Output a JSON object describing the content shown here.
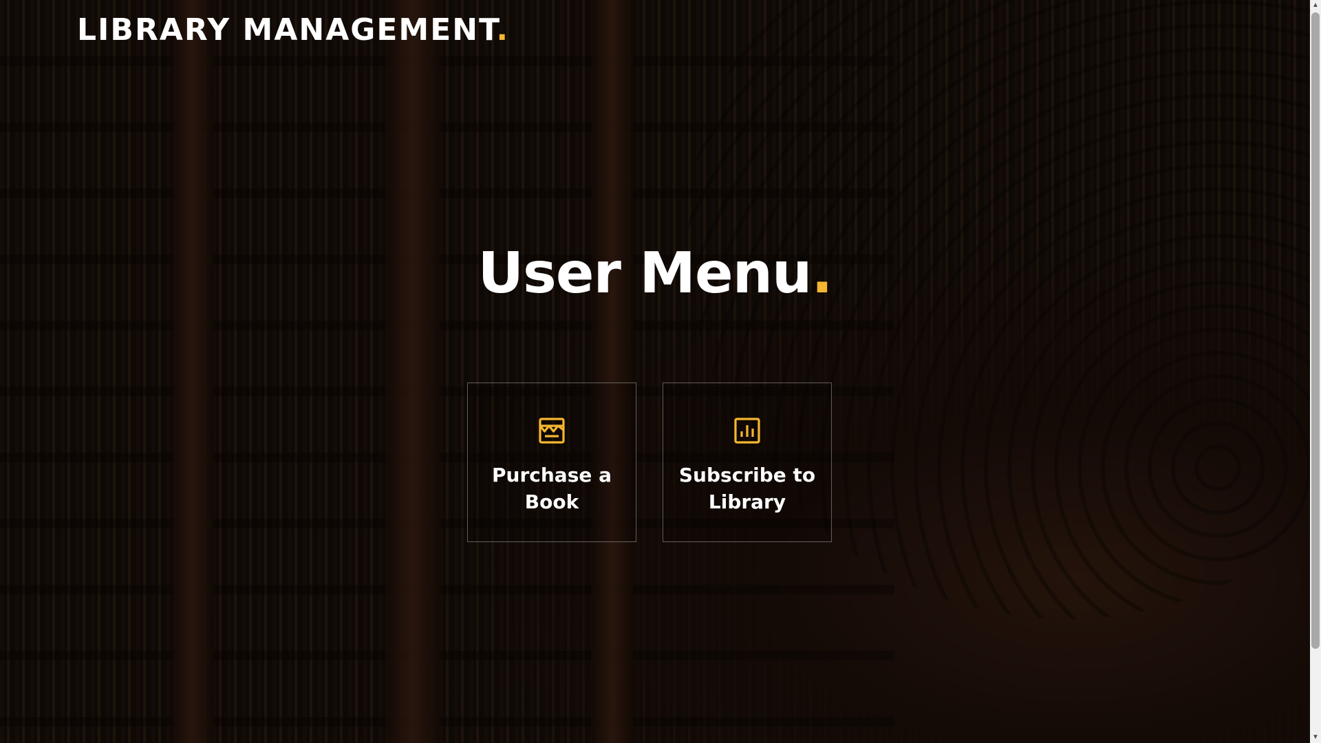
{
  "brand": {
    "text": "LIBRARY MANAGEMENT",
    "dot": "."
  },
  "page": {
    "title": "User Menu",
    "title_dot": "."
  },
  "cards": [
    {
      "label": "Purchase a Book",
      "icon": "store-icon"
    },
    {
      "label": "Subscribe to Library",
      "icon": "bar-chart-icon"
    }
  ],
  "colors": {
    "accent": "#f5b731",
    "text": "#ffffff",
    "scrollbar_thumb": "#a8a8a8"
  },
  "scrollbar": {
    "up": "▲",
    "down": "▼"
  }
}
